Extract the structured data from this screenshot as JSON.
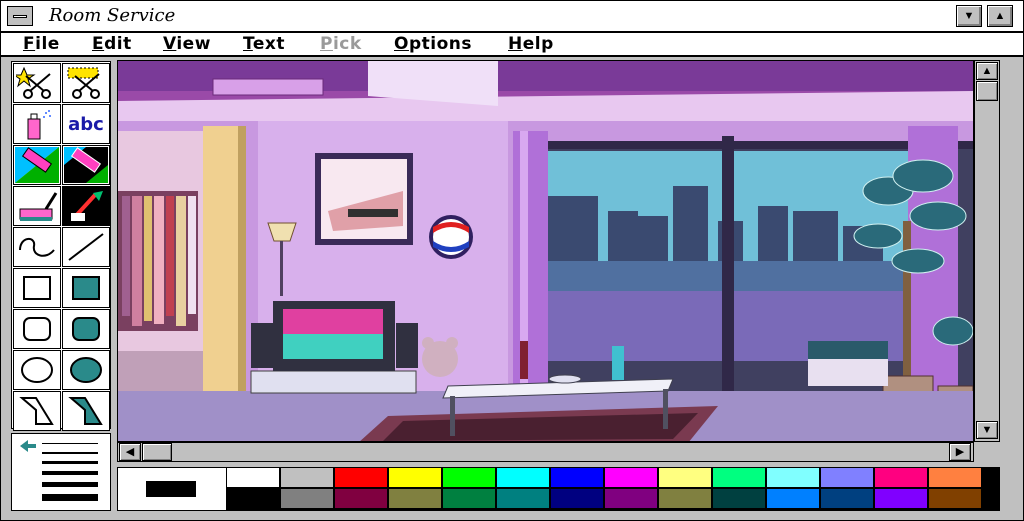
{
  "window": {
    "title": "Room Service"
  },
  "menu": [
    {
      "label": "File",
      "enabled": true
    },
    {
      "label": "Edit",
      "enabled": true
    },
    {
      "label": "View",
      "enabled": true
    },
    {
      "label": "Text",
      "enabled": true
    },
    {
      "label": "Pick",
      "enabled": false
    },
    {
      "label": "Options",
      "enabled": true
    },
    {
      "label": "Help",
      "enabled": true
    }
  ],
  "tools": [
    {
      "name": "pick-freeform-tool",
      "icon": "scissors-star-icon"
    },
    {
      "name": "pick-rectangle-tool",
      "icon": "scissors-rect-icon"
    },
    {
      "name": "airbrush-tool",
      "icon": "spray-can-icon"
    },
    {
      "name": "text-tool",
      "icon": "text-icon",
      "label": "abc"
    },
    {
      "name": "color-eraser-tool",
      "icon": "color-eraser-icon"
    },
    {
      "name": "eraser-tool",
      "icon": "eraser-icon"
    },
    {
      "name": "paint-roller-tool",
      "icon": "paint-roller-icon"
    },
    {
      "name": "brush-tool",
      "icon": "brush-icon",
      "selected": true
    },
    {
      "name": "curve-tool",
      "icon": "curve-icon"
    },
    {
      "name": "line-tool",
      "icon": "line-icon"
    },
    {
      "name": "box-tool",
      "icon": "box-icon"
    },
    {
      "name": "filled-box-tool",
      "icon": "filled-box-icon"
    },
    {
      "name": "rounded-box-tool",
      "icon": "rounded-box-icon"
    },
    {
      "name": "filled-rounded-box-tool",
      "icon": "filled-rounded-box-icon"
    },
    {
      "name": "circle-tool",
      "icon": "circle-icon"
    },
    {
      "name": "filled-circle-tool",
      "icon": "filled-circle-icon"
    },
    {
      "name": "polygon-tool",
      "icon": "polygon-icon"
    },
    {
      "name": "filled-polygon-tool",
      "icon": "filled-polygon-icon"
    }
  ],
  "palette": {
    "foreground": "#000000",
    "background": "#ffffff",
    "top_row": [
      "#ffffff",
      "#c0c0c0",
      "#ff0000",
      "#ffff00",
      "#00ff00",
      "#00ffff",
      "#0000ff",
      "#ff00ff",
      "#ffff80",
      "#00ff80",
      "#80ffff",
      "#8080ff",
      "#ff0080",
      "#ff8040"
    ],
    "bottom_row": [
      "#000000",
      "#808080",
      "#800040",
      "#808040",
      "#008040",
      "#008080",
      "#000080",
      "#800080",
      "#808040",
      "#004040",
      "#0080ff",
      "#004080",
      "#8000ff",
      "#804000"
    ]
  }
}
